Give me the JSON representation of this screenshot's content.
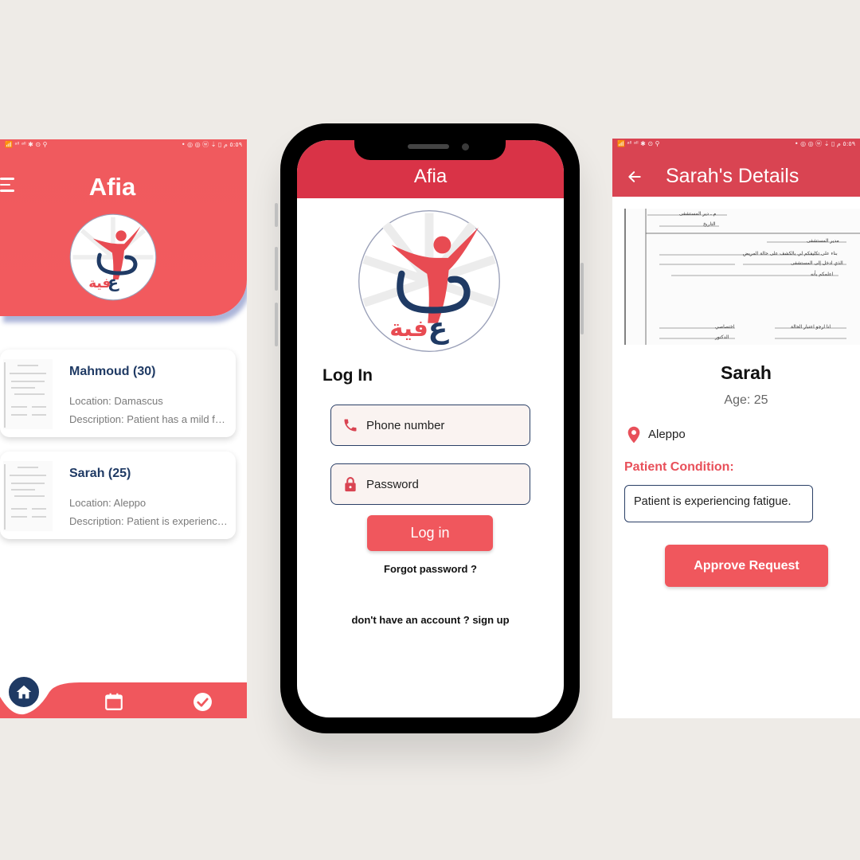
{
  "left_screen": {
    "status_left": "📶 ᵃˡˡ ᵃˡˡ ✱ ⊙ ⚲",
    "status_right": "• ◎ ◎ ⓦ ⇣ ▯ ٥:٥٩ م",
    "title": "Afia",
    "patients": [
      {
        "name": "Mahmoud (30)",
        "location": "Location: Damascus",
        "description": "Description: Patient has a mild fever"
      },
      {
        "name": "Sarah (25)",
        "location": "Location: Aleppo",
        "description": "Description: Patient is experiencing fatigue."
      }
    ],
    "nav_icons": [
      "home-icon",
      "calendar-icon",
      "check-circle-icon"
    ]
  },
  "center_screen": {
    "title": "Afia",
    "login_title": "Log In",
    "phone_placeholder": "Phone number",
    "password_placeholder": "Password",
    "login_button": "Log in",
    "forgot_password": "Forgot password ?",
    "signup": "don't have an account ? sign up"
  },
  "right_screen": {
    "title": "Sarah's Details",
    "name": "Sarah",
    "age": "Age: 25",
    "location": "Aleppo",
    "condition_label": "Patient Condition:",
    "condition_value": "Patient is experiencing fatigue.",
    "approve_button": "Approve Request"
  },
  "colors": {
    "primary_red": "#f0575d",
    "header_red": "#d93347",
    "navy": "#1f3a64",
    "background": "#eeebe7"
  }
}
